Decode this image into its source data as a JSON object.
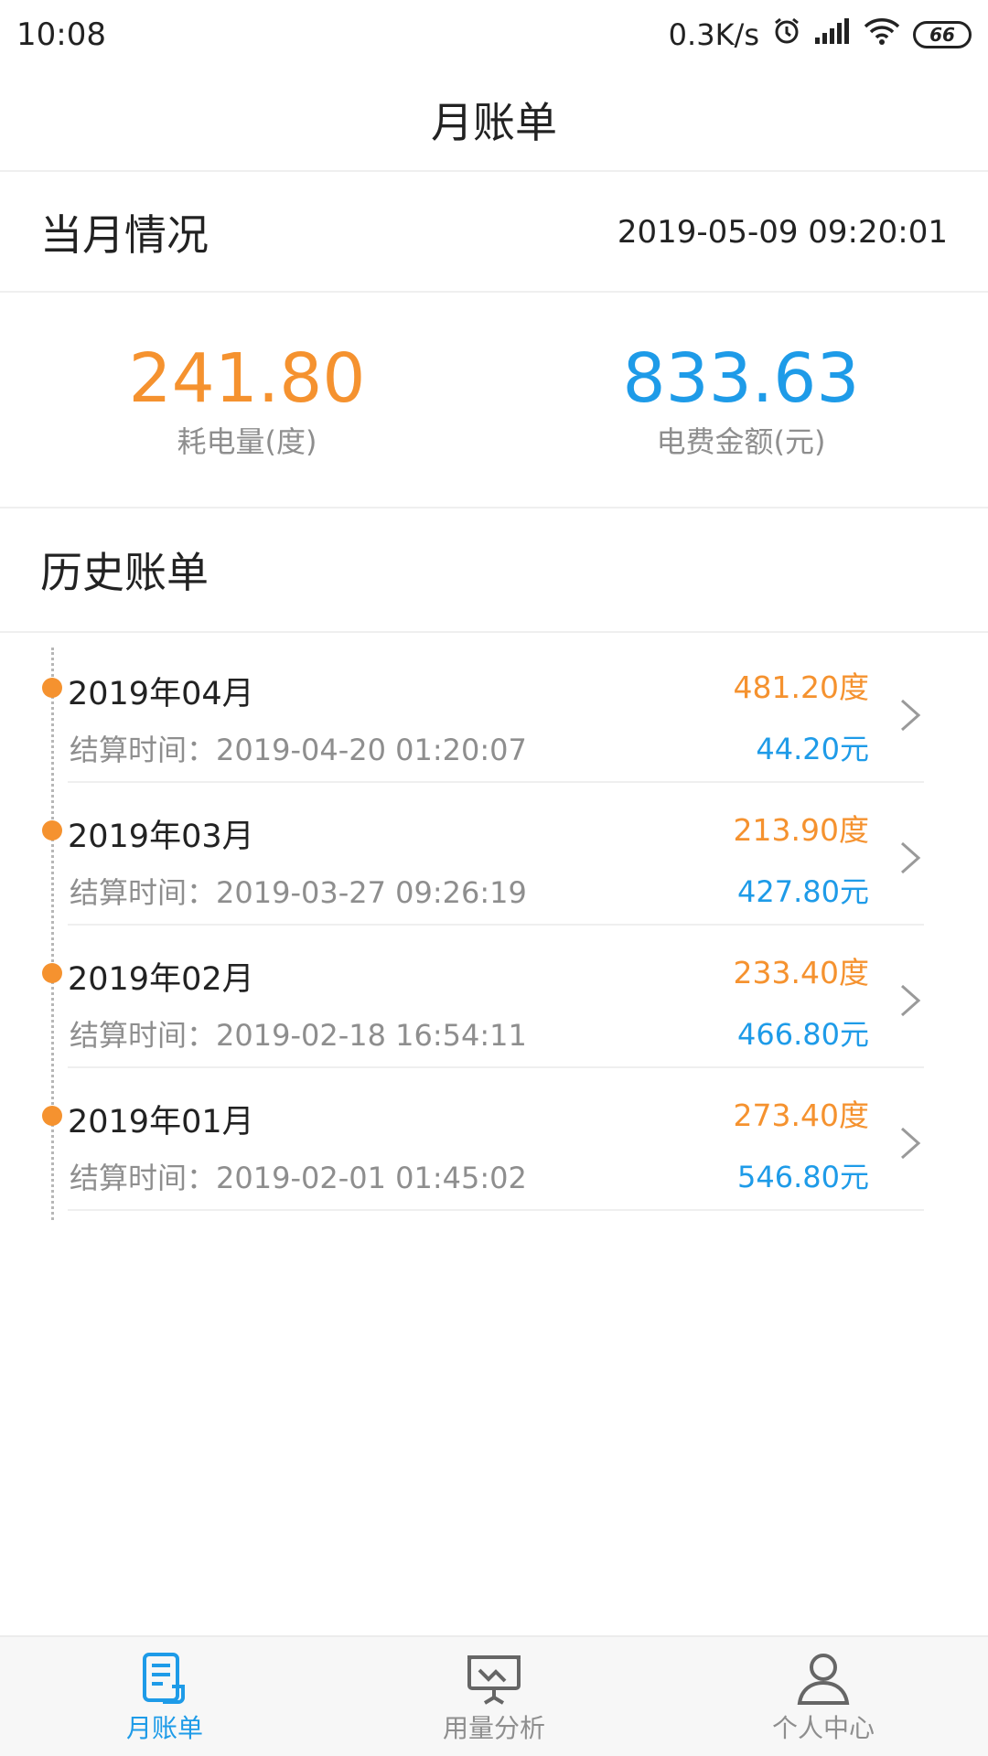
{
  "status_bar": {
    "time": "10:08",
    "net_speed": "0.3K/s",
    "battery": "66",
    "icons": [
      "alarm-icon",
      "signal-icon",
      "wifi-icon",
      "battery-icon"
    ]
  },
  "header": {
    "title": "月账单"
  },
  "current": {
    "title": "当月情况",
    "timestamp": "2019-05-09 09:20:01",
    "usage": {
      "value": "241.80",
      "label": "耗电量(度)"
    },
    "fee": {
      "value": "833.63",
      "label": "电费金额(元)"
    }
  },
  "history": {
    "title": "历史账单",
    "items": [
      {
        "month": "2019年04月",
        "settle": "结算时间：2019-04-20 01:20:07",
        "kwh": "481.20度",
        "amount": "44.20元"
      },
      {
        "month": "2019年03月",
        "settle": "结算时间：2019-03-27 09:26:19",
        "kwh": "213.90度",
        "amount": "427.80元"
      },
      {
        "month": "2019年02月",
        "settle": "结算时间：2019-02-18 16:54:11",
        "kwh": "233.40度",
        "amount": "466.80元"
      },
      {
        "month": "2019年01月",
        "settle": "结算时间：2019-02-01 01:45:02",
        "kwh": "273.40度",
        "amount": "546.80元"
      }
    ]
  },
  "nav": {
    "items": [
      {
        "label": "月账单",
        "icon": "bill-icon",
        "active": true
      },
      {
        "label": "用量分析",
        "icon": "analysis-icon",
        "active": false
      },
      {
        "label": "个人中心",
        "icon": "user-icon",
        "active": false
      }
    ]
  },
  "colors": {
    "orange": "#f5922f",
    "blue": "#1e9be8",
    "gray_text": "#8e8e8e"
  }
}
